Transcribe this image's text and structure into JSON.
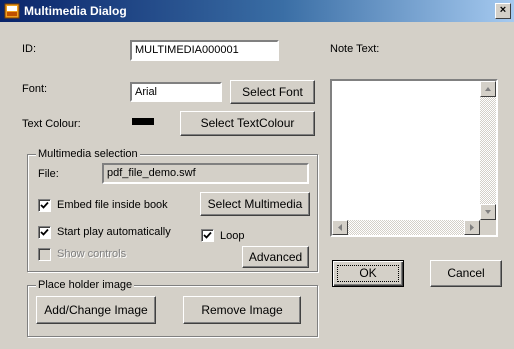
{
  "window": {
    "title": "Multimedia Dialog",
    "close_glyph": "×"
  },
  "id": {
    "label": "ID:",
    "value": "MULTIMEDIA000001"
  },
  "note": {
    "label": "Note Text:",
    "value": ""
  },
  "font": {
    "label": "Font:",
    "value": "Arial",
    "button": "Select Font"
  },
  "text_colour": {
    "label": "Text Colour:",
    "swatch_color": "#000000",
    "button": "Select TextColour"
  },
  "multimedia": {
    "legend": "Multimedia selection",
    "file_label": "File:",
    "file_value": "pdf_file_demo.swf",
    "embed": {
      "label": "Embed file inside book",
      "checked": true
    },
    "select_button": "Select Multimedia",
    "autoplay": {
      "label": "Start play automatically",
      "checked": true
    },
    "loop": {
      "label": "Loop",
      "checked": true
    },
    "show_controls": {
      "label": "Show controls",
      "checked": false,
      "disabled": true
    },
    "advanced_button": "Advanced"
  },
  "placeholder": {
    "legend": "Place holder image",
    "add_button": "Add/Change Image",
    "remove_button": "Remove Image"
  },
  "dialog": {
    "ok_button": "OK",
    "cancel_button": "Cancel"
  },
  "icons": [
    "app-icon",
    "close-icon",
    "scroll-up-icon",
    "scroll-down-icon",
    "scroll-left-icon",
    "scroll-right-icon",
    "checkmark-icon"
  ]
}
